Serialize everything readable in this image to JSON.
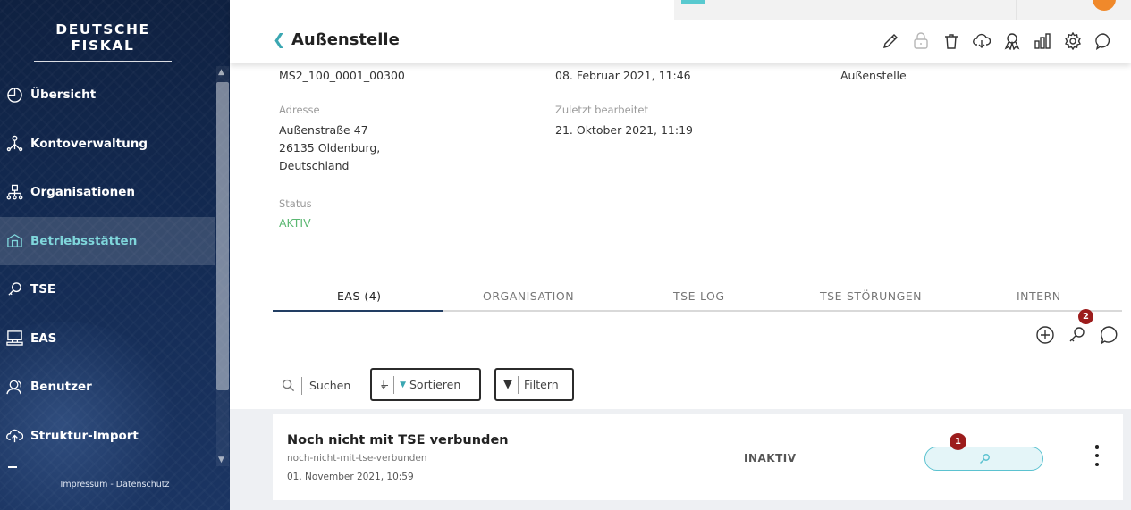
{
  "brand": "DEUTSCHE FISKAL",
  "nav": [
    {
      "label": "Übersicht",
      "icon": "dashboard-icon"
    },
    {
      "label": "Kontoverwaltung",
      "icon": "account-tree-icon"
    },
    {
      "label": "Organisationen",
      "icon": "org-chart-icon"
    },
    {
      "label": "Betriebsstätten",
      "icon": "building-icon",
      "active": true
    },
    {
      "label": "TSE",
      "icon": "key-icon"
    },
    {
      "label": "EAS",
      "icon": "register-icon"
    },
    {
      "label": "Benutzer",
      "icon": "users-icon"
    },
    {
      "label": "Struktur-Import",
      "icon": "cloud-upload-icon"
    }
  ],
  "footer": "Impressum - Datenschutz",
  "header": {
    "title": "Außenstelle"
  },
  "details": {
    "id": "MS2_100_0001_00300",
    "created": "08. Februar 2021, 11:46",
    "type": "Außenstelle",
    "address_label": "Adresse",
    "address_line1": "Außenstraße 47",
    "address_line2": "26135  Oldenburg,",
    "address_line3": "Deutschland",
    "edited_label": "Zuletzt bearbeitet",
    "edited_value": "21. Oktober 2021, 11:19",
    "status_label": "Status",
    "status_value": "AKTIV"
  },
  "tabs": [
    "EAS (4)",
    "ORGANISATION",
    "TSE-LOG",
    "TSE-STÖRUNGEN",
    "INTERN"
  ],
  "actions": {
    "key_badge": "2"
  },
  "toolbar": {
    "search": "Suchen",
    "sort": "Sortieren",
    "filter": "Filtern"
  },
  "row": {
    "title": "Noch nicht mit TSE verbunden",
    "slug": "noch-nicht-mit-tse-verbunden",
    "date": "01. November 2021, 10:59",
    "status": "INAKTIV",
    "badge": "1"
  },
  "colors": {
    "accent": "#3ba7b2",
    "active_nav": "#7fd6db",
    "status_active": "#5bb872",
    "badge": "#9c1c1c",
    "sidebar": "#132a52"
  }
}
